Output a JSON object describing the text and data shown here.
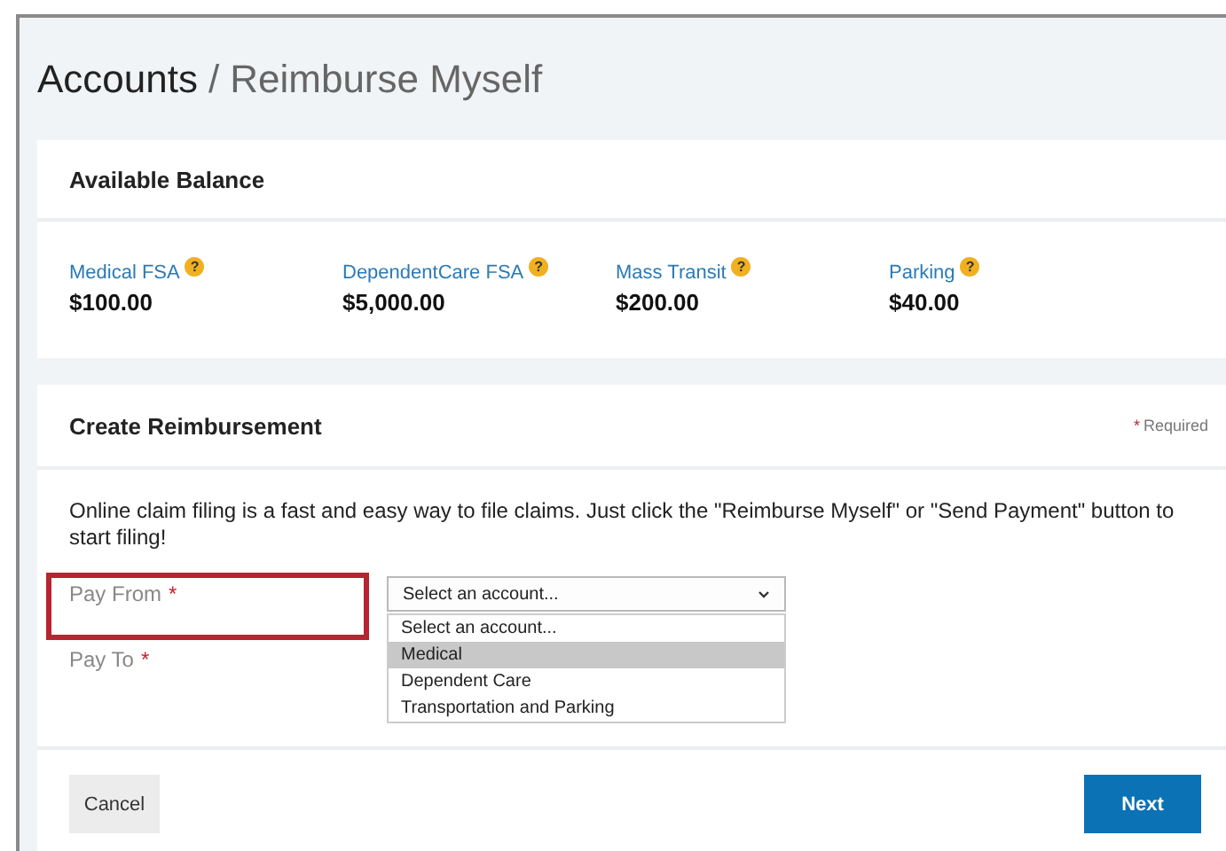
{
  "breadcrumb": {
    "parent": "Accounts",
    "separator": "/",
    "current": "Reimburse Myself"
  },
  "balance": {
    "title": "Available Balance",
    "accounts": [
      {
        "name": "Medical FSA",
        "help": "?",
        "amount": "$100.00"
      },
      {
        "name": "DependentCare FSA",
        "help": "?",
        "amount": "$5,000.00"
      },
      {
        "name": "Mass Transit",
        "help": "?",
        "amount": "$200.00"
      },
      {
        "name": "Parking",
        "help": "?",
        "amount": "$40.00"
      }
    ]
  },
  "reimbursement": {
    "title": "Create Reimbursement",
    "required_mark": "*",
    "required_note": "Required",
    "intro": "Online claim filing is a fast and easy way to file claims. Just click the \"Reimburse Myself\" or \"Send Payment\" button to start filing!",
    "fields": [
      {
        "label": "Pay From",
        "required": true,
        "highlighted": true,
        "value": "Select an account...",
        "expanded": true,
        "options": [
          {
            "label": "Select an account...",
            "hovered": false
          },
          {
            "label": "Medical",
            "hovered": true
          },
          {
            "label": "Dependent Care",
            "hovered": false
          },
          {
            "label": "Transportation and Parking",
            "hovered": false
          }
        ]
      },
      {
        "label": "Pay To",
        "required": true,
        "highlighted": false
      }
    ],
    "buttons": [
      {
        "label": "Cancel",
        "kind": "secondary"
      },
      {
        "label": "Next",
        "kind": "primary"
      }
    ]
  }
}
